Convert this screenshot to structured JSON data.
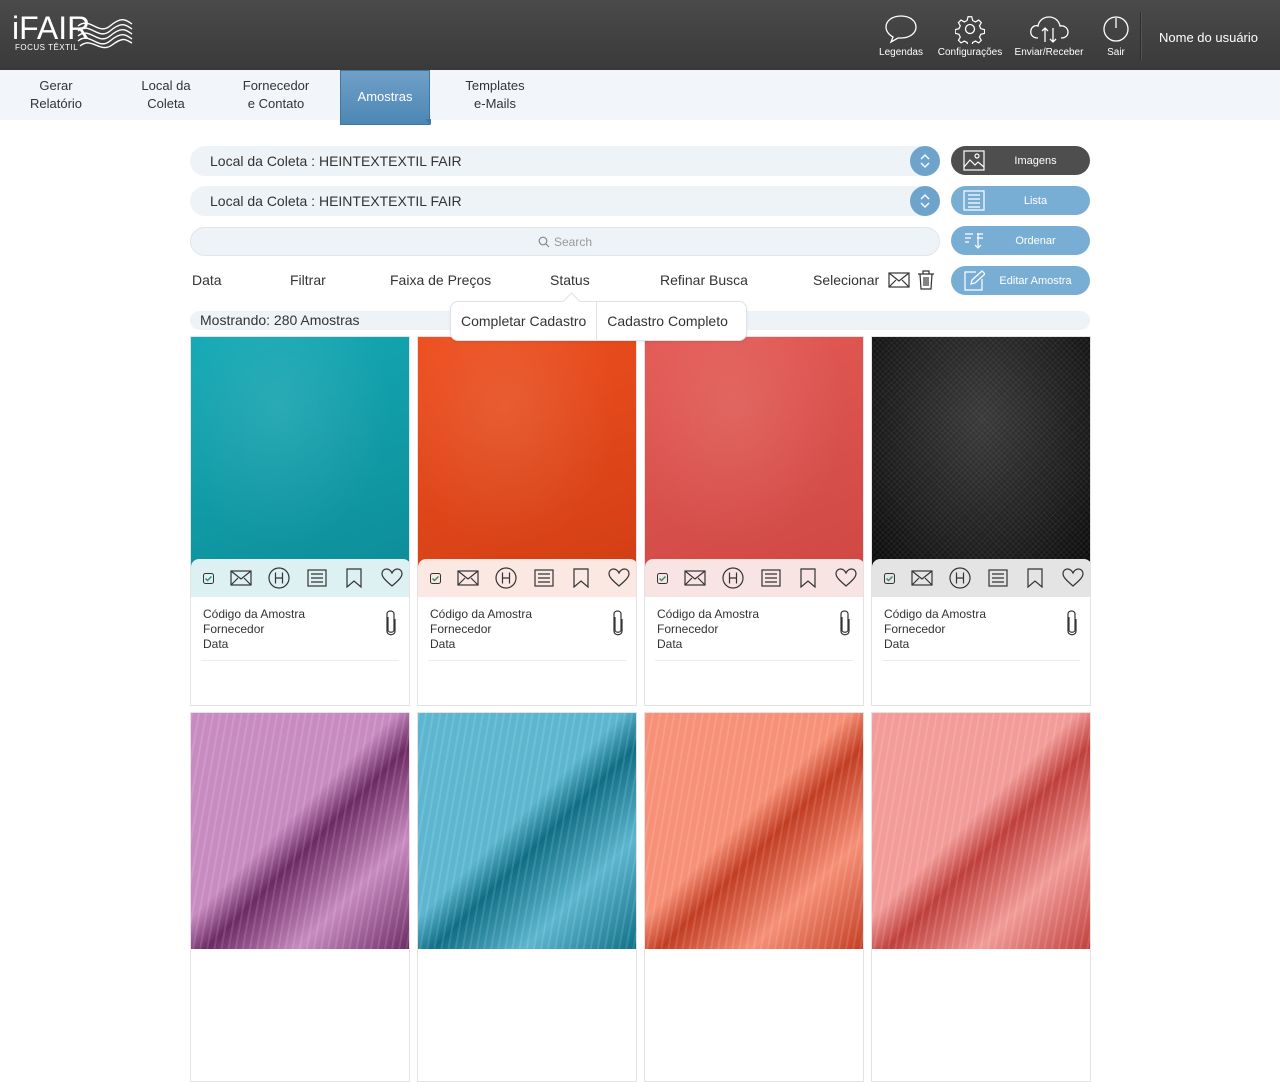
{
  "brand": {
    "logo": "iFAIR",
    "tagline": "FOCUS TÊXTIL"
  },
  "header": {
    "actions": [
      {
        "label": "Legendas",
        "icon": "speech-bubble-icon"
      },
      {
        "label": "Configurações",
        "icon": "gear-icon"
      },
      {
        "label": "Enviar/Receber",
        "icon": "cloud-sync-icon"
      },
      {
        "label": "Sair",
        "icon": "power-icon"
      }
    ],
    "username": "Nome do usuário"
  },
  "tabs": [
    {
      "label": "Gerar\nRelatório",
      "active": false
    },
    {
      "label": "Local da\nColeta",
      "active": false
    },
    {
      "label": "Fornecedor\ne Contato",
      "active": false
    },
    {
      "label": "Amostras",
      "active": true
    },
    {
      "label": "Templates\ne-Mails",
      "active": false
    }
  ],
  "filters": {
    "select1": "Local da Coleta :  HEINTEXTEXTIL FAIR",
    "select2": "Local da Coleta :  HEINTEXTEXTIL FAIR",
    "search_placeholder": "Search",
    "bar": [
      "Data",
      "Filtrar",
      "Faixa de Preços",
      "Status",
      "Refinar Busca",
      "Selecionar"
    ]
  },
  "side_buttons": [
    {
      "label": "Imagens",
      "icon": "image-icon",
      "style": "dark"
    },
    {
      "label": "Lista",
      "icon": "list-icon",
      "style": "blue"
    },
    {
      "label": "Ordenar",
      "icon": "sort-icon",
      "style": "blue"
    },
    {
      "label": "Editar Amostra",
      "icon": "edit-icon",
      "style": "blue"
    }
  ],
  "showing": "Mostrando: 280 Amostras",
  "status_menu": [
    "Completar Cadastro",
    "Cadastro Completo"
  ],
  "card_labels": {
    "code": "Código da Amostra",
    "supplier": "Fornecedor",
    "date": "Data"
  },
  "samples": [
    {
      "color": "#14a9b5",
      "shade": "#0d8e99",
      "bar": "#ddf1f3",
      "pattern": "plain"
    },
    {
      "color": "#ee4f1f",
      "shade": "#d23f14",
      "bar": "#fbe8e3",
      "pattern": "plain"
    },
    {
      "color": "#e45a55",
      "shade": "#cf4843",
      "bar": "#f8e4e3",
      "pattern": "plain"
    },
    {
      "color": "#1f1f1f",
      "shade": "#0a0a0a",
      "bar": "#e4e4e4",
      "pattern": "weave"
    },
    {
      "color": "#c88bc0",
      "shade": "#6c2a63",
      "bar": "#f3e6f1",
      "pattern": "crinkle"
    },
    {
      "color": "#5cb6cf",
      "shade": "#0f6e85",
      "bar": "#e0f1f6",
      "pattern": "crinkle"
    },
    {
      "color": "#f69077",
      "shade": "#c23d22",
      "bar": "#fde8e2",
      "pattern": "crinkle"
    },
    {
      "color": "#f29b98",
      "shade": "#bf3f3b",
      "bar": "#fde8e8",
      "pattern": "crinkle"
    }
  ],
  "colors": {
    "accent": "#78aed4",
    "topbar": "#3f3f3f",
    "tab_active": "#5a91bd"
  }
}
